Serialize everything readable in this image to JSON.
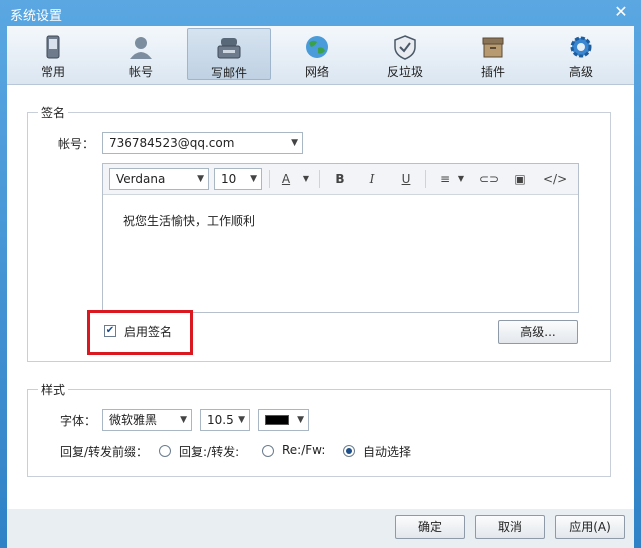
{
  "window": {
    "title": "系统设置"
  },
  "toolbar": {
    "items": [
      {
        "label": "常用",
        "icon": "phone-icon"
      },
      {
        "label": "帐号",
        "icon": "user-icon"
      },
      {
        "label": "写邮件",
        "icon": "write-mail-icon",
        "active": true
      },
      {
        "label": "网络",
        "icon": "globe-icon"
      },
      {
        "label": "反垃圾",
        "icon": "shield-icon"
      },
      {
        "label": "插件",
        "icon": "plugin-box-icon"
      },
      {
        "label": "高级",
        "icon": "gear-icon"
      }
    ]
  },
  "signature": {
    "group_title": "签名",
    "account_label": "帐号：",
    "account_value": "736784523@qq.com",
    "font_value": "Verdana",
    "size_value": "10",
    "format_buttons": {
      "bold": "B",
      "italic": "I",
      "underline": "U",
      "code": "</>"
    },
    "content": "祝您生活愉快，工作顺利",
    "enable_label": "启用签名",
    "enable_checked": true,
    "advanced_button": "高级..."
  },
  "style": {
    "group_title": "样式",
    "font_label": "字体：",
    "font_value": "微软雅黑",
    "size_value": "10.5",
    "color_value": "#000000",
    "prefix_label": "回复/转发前缀：",
    "options": [
      "回复:/转发:",
      "Re:/Fw:",
      "自动选择"
    ],
    "selected_option": "自动选择"
  },
  "footer": {
    "ok": "确定",
    "cancel": "取消",
    "apply": "应用(A)"
  },
  "colors": {
    "highlight": "#d9181f",
    "titlebar": "#2f82c6"
  }
}
